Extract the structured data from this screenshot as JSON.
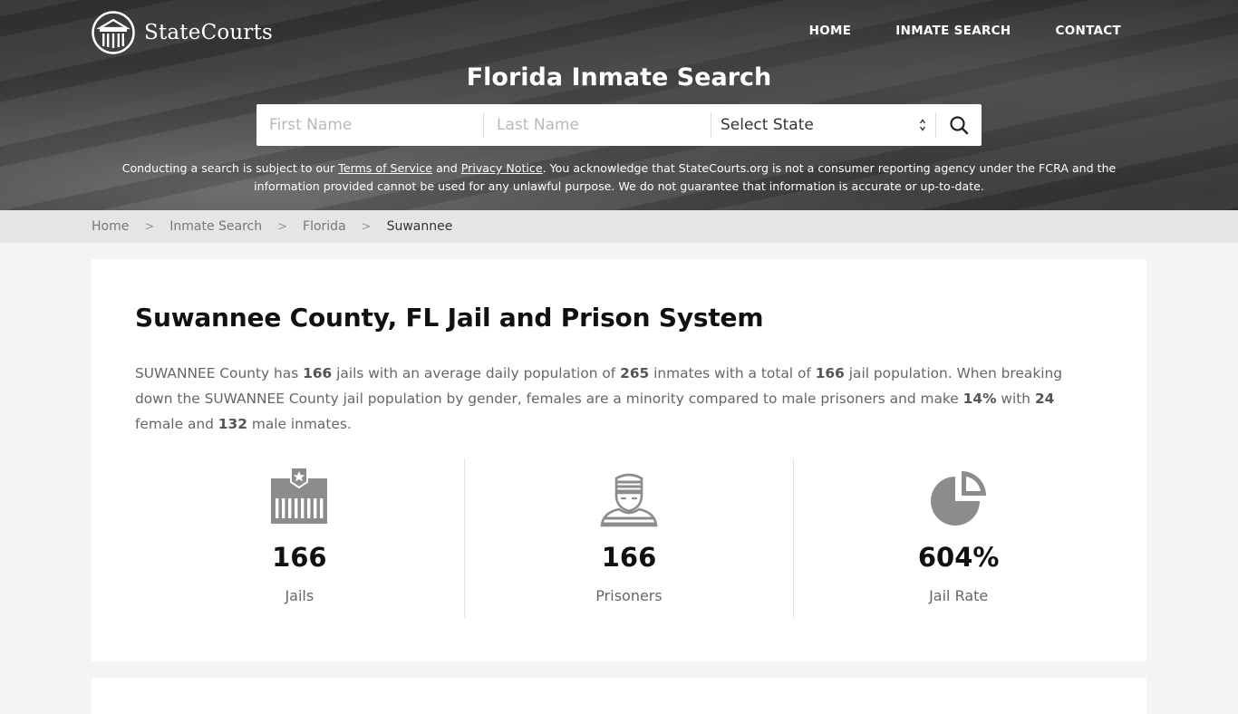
{
  "brand": {
    "name": "StateCourts",
    "logo_icon": "courthouse-columns-icon"
  },
  "nav": {
    "items": [
      {
        "label": "HOME"
      },
      {
        "label": "INMATE SEARCH"
      },
      {
        "label": "CONTACT"
      }
    ]
  },
  "hero": {
    "title": "Florida Inmate Search",
    "search": {
      "first_name_placeholder": "First Name",
      "first_name_value": "",
      "last_name_placeholder": "Last Name",
      "last_name_value": "",
      "state_selected": "Select State",
      "search_icon": "magnifier-icon"
    },
    "disclaimer": {
      "part1": "Conducting a search is subject to our ",
      "terms_link": "Terms of Service",
      "part2": " and ",
      "privacy_link": "Privacy Notice",
      "part3": ". You acknowledge that StateCourts.org is not a consumer reporting agency under the FCRA and the information provided cannot be used for any unlawful purpose. We do not guarantee that information is accurate or up-to-date."
    }
  },
  "breadcrumb": {
    "items": [
      {
        "label": "Home"
      },
      {
        "label": "Inmate Search"
      },
      {
        "label": "Florida"
      }
    ],
    "current": "Suwannee"
  },
  "main": {
    "title": "Suwannee County, FL Jail and Prison System",
    "description": {
      "t1": "SUWANNEE County has ",
      "jails": "166",
      "t2": " jails with an average daily population of ",
      "avg_daily_population": "265",
      "t3": " inmates with a total of ",
      "total_population": "166",
      "t4": " jail population. When breaking down the SUWANNEE County jail population by gender, females are a minority compared to male prisoners and make ",
      "female_percent": "14%",
      "t5": " with ",
      "female_count": "24",
      "t6": " female and ",
      "male_count": "132",
      "t7": " male inmates."
    },
    "stats": [
      {
        "icon": "jail-building-icon",
        "value": "166",
        "label": "Jails"
      },
      {
        "icon": "prisoner-icon",
        "value": "166",
        "label": "Prisoners"
      },
      {
        "icon": "pie-chart-icon",
        "value": "604%",
        "label": "Jail Rate"
      }
    ]
  },
  "colors": {
    "icon_gray": "#8c8c8c",
    "page_bg": "#f4f4f4",
    "breadcrumb_bg": "#e5e5e5"
  }
}
